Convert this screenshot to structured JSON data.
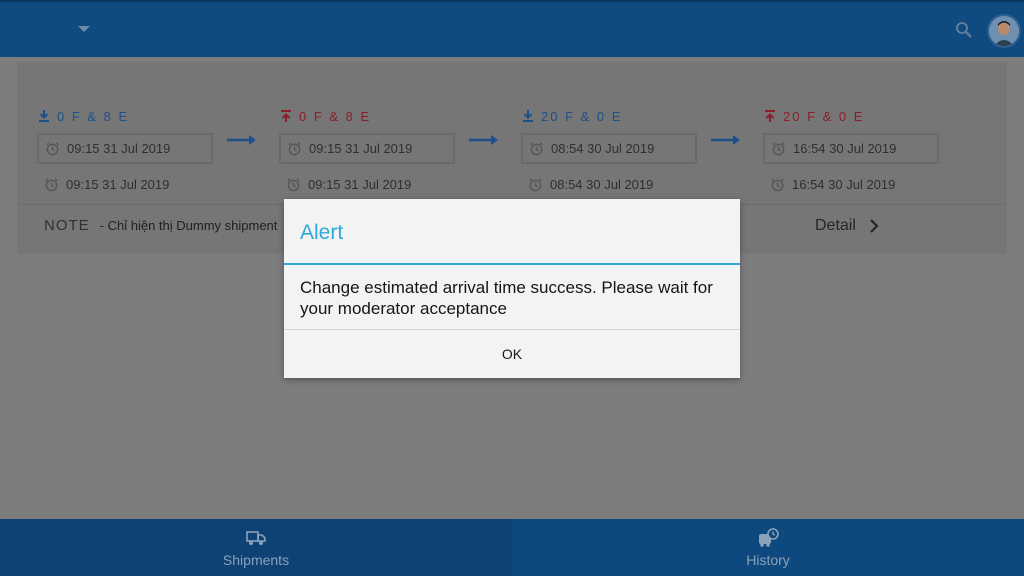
{
  "header": {
    "dropdown_icon": "caret-down-icon",
    "search_icon": "search-icon",
    "avatar_icon": "user-avatar"
  },
  "route": {
    "steps": [
      {
        "kind": "unload",
        "icon": "download-icon",
        "label": "0 F & 8 E",
        "estimated": "09:15 31 Jul 2019",
        "actual": "09:15 31 Jul 2019"
      },
      {
        "kind": "load",
        "icon": "upload-icon",
        "label": "0 F & 8 E",
        "estimated": "09:15 31 Jul 2019",
        "actual": "09:15 31 Jul 2019"
      },
      {
        "kind": "unload",
        "icon": "download-icon",
        "label": "20 F & 0 E",
        "estimated": "08:54 30 Jul 2019",
        "actual": "08:54 30 Jul 2019"
      },
      {
        "kind": "load",
        "icon": "upload-icon",
        "label": "20 F & 0 E",
        "estimated": "16:54 30 Jul 2019",
        "actual": "16:54 30 Jul 2019"
      }
    ],
    "note_label": "NOTE",
    "note_text": "- Chỉ hiện thị Dummy shipment",
    "detail_label": "Detail"
  },
  "tabs": [
    {
      "label": "Shipments",
      "icon": "truck-icon"
    },
    {
      "label": "History",
      "icon": "history-icon"
    }
  ],
  "dialog": {
    "title": "Alert",
    "message": "Change estimated arrival time success. Please wait for your moderator acceptance",
    "ok_label": "OK"
  },
  "colors": {
    "primary": "#0f4a80",
    "alert_title": "#2ca9d8",
    "unload": "#1d4f8a",
    "load": "#8a1e2a"
  }
}
